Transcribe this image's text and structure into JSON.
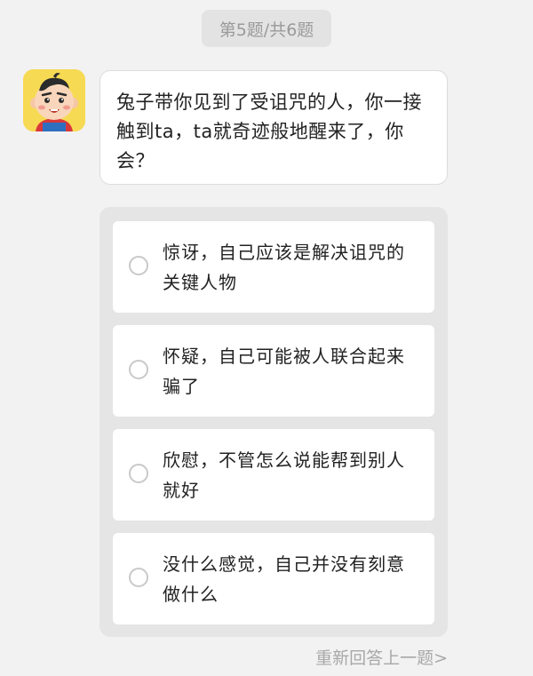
{
  "header": {
    "progress": "第5题/共6题"
  },
  "question": {
    "avatar_icon": "cartoon-boy-avatar",
    "text": "兔子带你见到了受诅咒的人，你一接触到ta，ta就奇迹般地醒来了，你会？"
  },
  "options": [
    {
      "label": "惊讶，自己应该是解决诅咒的关键人物"
    },
    {
      "label": "怀疑，自己可能被人联合起来骗了"
    },
    {
      "label": "欣慰，不管怎么说能帮到别人就好"
    },
    {
      "label": "没什么感觉，自己并没有刻意做什么"
    }
  ],
  "footer": {
    "redo_label": "重新回答上一题>"
  },
  "colors": {
    "background": "#f2f2f2",
    "avatar_bg": "#f7da53",
    "panel": "#e5e5e5",
    "muted_text": "#a8a8a8"
  }
}
